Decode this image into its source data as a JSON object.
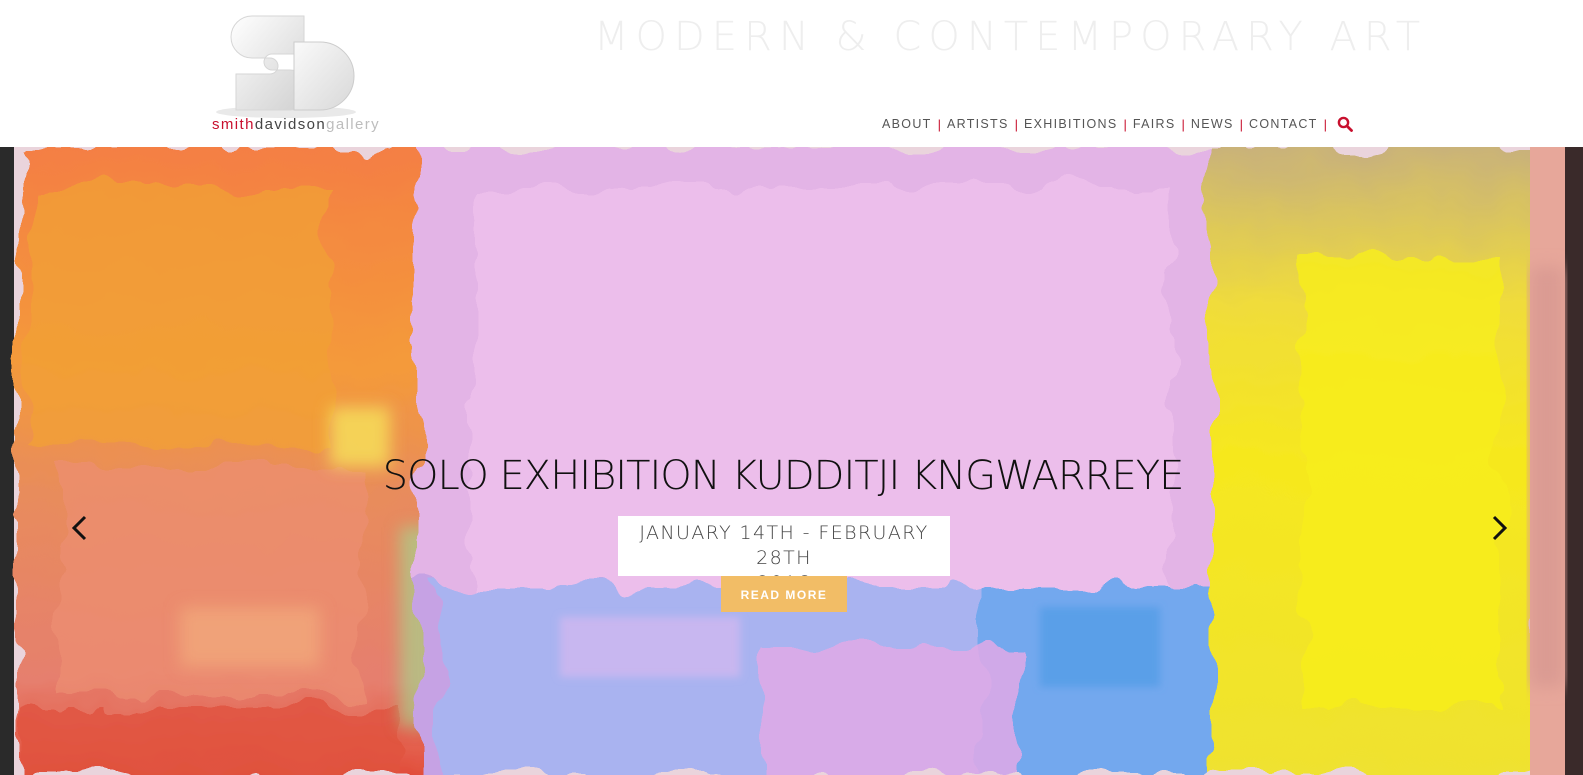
{
  "brand": {
    "logo_word1": "smith",
    "logo_word2": "davidson",
    "logo_word3": "gallery",
    "accent_color": "#c8102e"
  },
  "header": {
    "tagline": "MODERN & CONTEMPORARY ART"
  },
  "nav": {
    "items": [
      {
        "label": "ABOUT"
      },
      {
        "label": "ARTISTS"
      },
      {
        "label": "EXHIBITIONS"
      },
      {
        "label": "FAIRS"
      },
      {
        "label": "NEWS"
      },
      {
        "label": "CONTACT"
      }
    ],
    "separator": "|",
    "search_icon": "search-icon"
  },
  "hero": {
    "title": "SOLO EXHIBITION KUDDITJI KNGWARREYE",
    "date_line1": "JANUARY 14TH - FEBRUARY 28TH",
    "date_line2": "2016",
    "cta_label": "READ MORE",
    "cta_color": "#f2bd66",
    "prev_icon": "chevron-left-icon",
    "next_icon": "chevron-right-icon"
  }
}
